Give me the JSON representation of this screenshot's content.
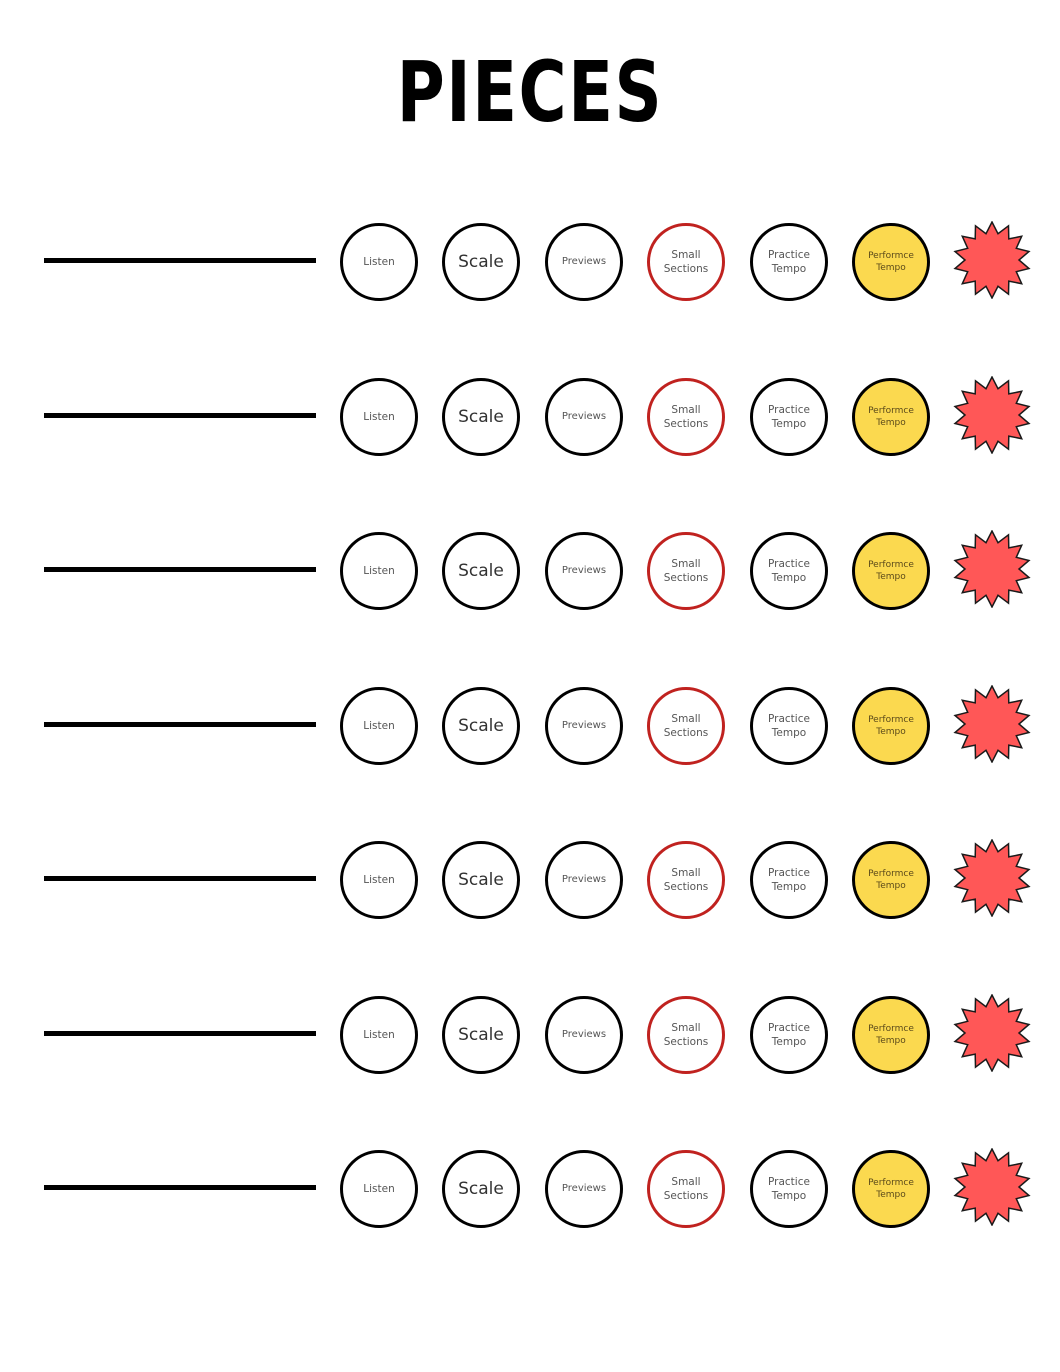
{
  "title": "PIECES",
  "colors": {
    "line": "#000000",
    "circle_border": "#000000",
    "small_sections_border": "#c0221f",
    "performance_fill": "#fbd94f",
    "star_fill": "#ff5757"
  },
  "steps": {
    "listen": "Listen",
    "scale": "Scale",
    "previews": "Previews",
    "small_sections_line1": "Small",
    "small_sections_line2": "Sections",
    "practice_tempo_line1": "Practice",
    "practice_tempo_line2": "Tempo",
    "performance_tempo_line1": "Performce",
    "performance_tempo_line2": "Tempo",
    "complete_icon": "starburst-icon"
  },
  "rows": [
    {
      "piece_name": ""
    },
    {
      "piece_name": ""
    },
    {
      "piece_name": ""
    },
    {
      "piece_name": ""
    },
    {
      "piece_name": ""
    },
    {
      "piece_name": ""
    },
    {
      "piece_name": ""
    }
  ]
}
